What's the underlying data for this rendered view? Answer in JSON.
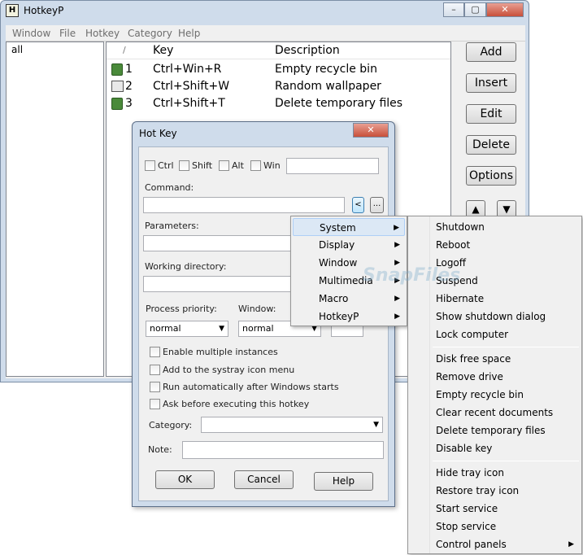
{
  "window": {
    "title": "HotkeyP",
    "app_icon": "H",
    "minimize": "–",
    "maximize": "▢",
    "close": "✕"
  },
  "menubar": [
    "Window",
    "File",
    "Hotkey",
    "Category",
    "Help"
  ],
  "tree": {
    "items": [
      "all"
    ]
  },
  "list": {
    "columns": [
      "/",
      "Key",
      "Description"
    ],
    "rows": [
      {
        "num": "1",
        "key": "Ctrl+Win+R",
        "desc": "Empty recycle bin",
        "icon": "recycle-bin-icon"
      },
      {
        "num": "2",
        "key": "Ctrl+Shift+W",
        "desc": "Random wallpaper",
        "icon": "wallpaper-icon"
      },
      {
        "num": "3",
        "key": "Ctrl+Shift+T",
        "desc": "Delete temporary files",
        "icon": "recycle-bin-icon"
      }
    ]
  },
  "buttons": {
    "add": "Add",
    "insert": "Insert",
    "edit": "Edit",
    "delete": "Delete",
    "options": "Options",
    "up": "▲",
    "down": "▼"
  },
  "dialog": {
    "title": "Hot Key",
    "close": "✕",
    "mods": {
      "ctrl": "Ctrl",
      "shift": "Shift",
      "alt": "Alt",
      "win": "Win"
    },
    "command_label": "Command:",
    "cmd_menu_btn": "<",
    "browse_btn": "...",
    "parameters_label": "Parameters:",
    "workdir_label": "Working directory:",
    "priority_label": "Process priority:",
    "priority_value": "normal",
    "window_label": "Window:",
    "window_value": "normal",
    "checks": {
      "multi": "Enable multiple instances",
      "systray": "Add to the systray icon menu",
      "autorun": "Run automatically after Windows starts",
      "ask": "Ask before executing this hotkey"
    },
    "category_label": "Category:",
    "note_label": "Note:",
    "ok": "OK",
    "cancel": "Cancel",
    "help": "Help"
  },
  "command_menu": {
    "items": [
      "System",
      "Display",
      "Window",
      "Multimedia",
      "Macro",
      "HotkeyP"
    ]
  },
  "system_submenu": {
    "group1": [
      "Shutdown",
      "Reboot",
      "Logoff",
      "Suspend",
      "Hibernate",
      "Show shutdown dialog",
      "Lock computer"
    ],
    "group2": [
      "Disk free space",
      "Remove drive",
      "Empty recycle bin",
      "Clear recent documents",
      "Delete temporary files",
      "Disable key"
    ],
    "group3": [
      "Hide tray icon",
      "Restore tray icon",
      "Start service",
      "Stop service",
      "Control panels"
    ]
  },
  "watermark": "SnapFiles"
}
